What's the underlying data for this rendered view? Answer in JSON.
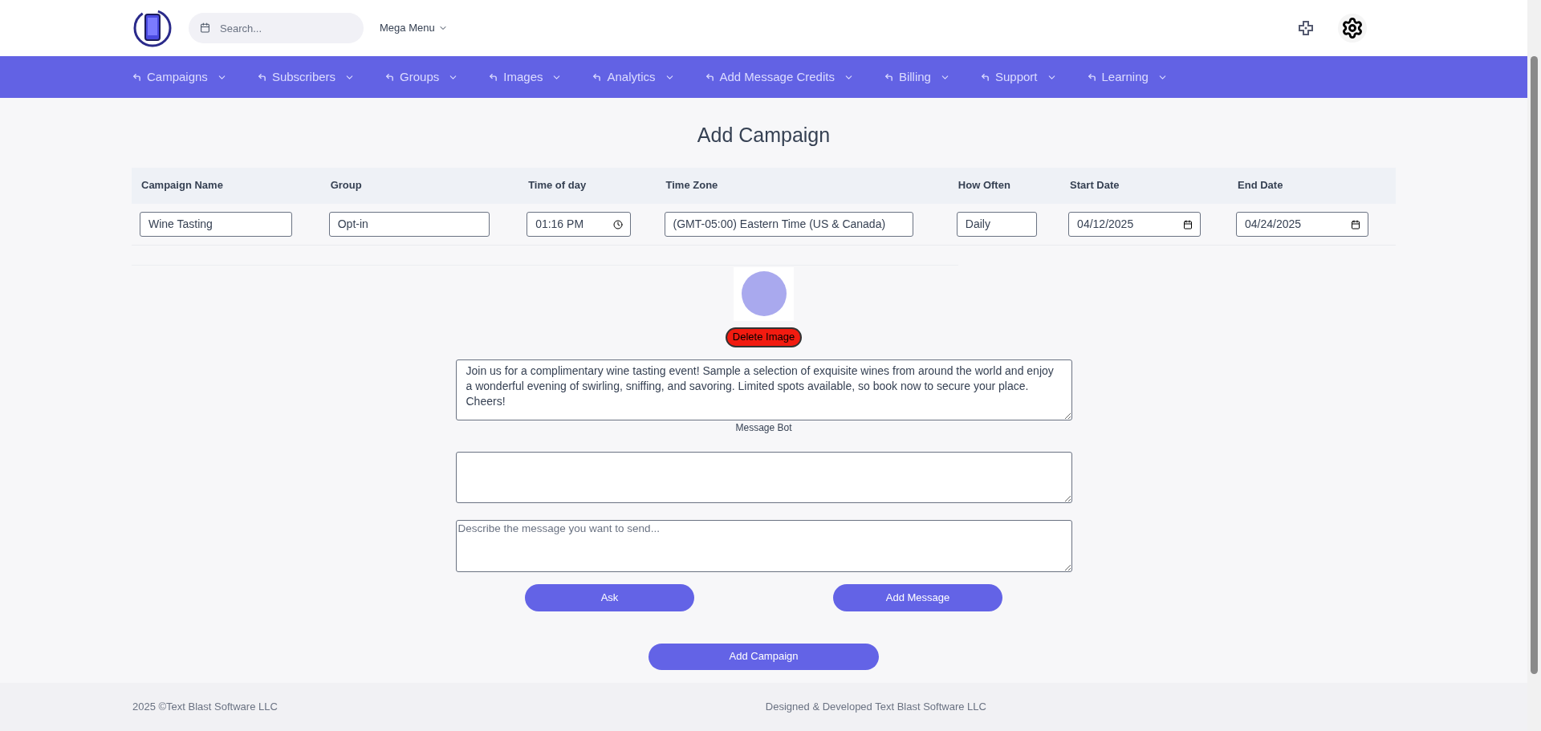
{
  "header": {
    "search": {
      "placeholder": "Search..."
    },
    "mega_menu": "Mega Menu"
  },
  "nav": [
    "Campaigns",
    "Subscribers",
    "Groups",
    "Images",
    "Analytics",
    "Add Message Credits",
    "Billing",
    "Support",
    "Learning"
  ],
  "title": "Add Campaign",
  "table": {
    "columns": [
      "Campaign Name",
      "Group",
      "Time of day",
      "Time Zone",
      "How Often",
      "Start Date",
      "End Date"
    ],
    "row": [
      {
        "kind": "text",
        "value": "Wine Tasting"
      },
      {
        "kind": "text",
        "value": "Opt-in"
      },
      {
        "kind": "time",
        "value": "01:16 PM"
      },
      {
        "kind": "text",
        "value": "(GMT-05:00) Eastern Time (US & Canada)"
      },
      {
        "kind": "text",
        "value": "Daily"
      },
      {
        "kind": "date",
        "value": "04/12/2025"
      },
      {
        "kind": "date",
        "value": "04/24/2025"
      }
    ]
  },
  "image": {
    "delete_button": "Delete Image"
  },
  "message": "Join us for a complimentary wine tasting event! Sample a selection of exquisite wines from around the world and enjoy a wonderful evening of swirling, sniffing, and savoring. Limited spots available, so book now to secure your place. Cheers!",
  "message_bot": {
    "label": "Message Bot",
    "prompt_placeholder": "Describe the message you want to send..."
  },
  "buttons": [
    "Ask",
    "Add Message"
  ],
  "submit": "Add Campaign",
  "footer": {
    "copyright": "2025 ©Text Blast Software LLC",
    "credit": "Designed & Developed Text Blast Software LLC"
  }
}
